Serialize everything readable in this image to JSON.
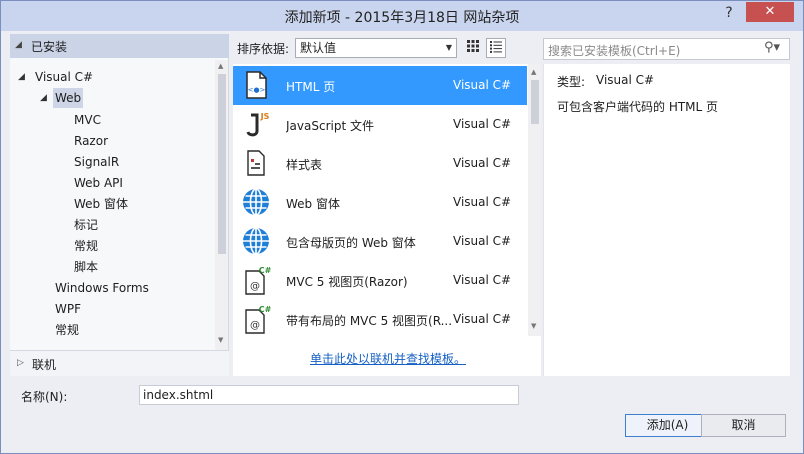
{
  "window": {
    "title": "添加新项 - 2015年3月18日 网站杂项",
    "help_label": "?",
    "close_label": "✕"
  },
  "tree": {
    "installed_label": "已安装",
    "items": [
      {
        "label": "Visual C#",
        "expanded": true
      },
      {
        "label": "Web",
        "expanded": true,
        "selected": true
      },
      {
        "label": "MVC"
      },
      {
        "label": "Razor"
      },
      {
        "label": "SignalR"
      },
      {
        "label": "Web API"
      },
      {
        "label": "Web 窗体"
      },
      {
        "label": "标记"
      },
      {
        "label": "常规"
      },
      {
        "label": "脚本"
      },
      {
        "label": "Windows Forms"
      },
      {
        "label": "WPF"
      },
      {
        "label": "常规"
      }
    ],
    "online_label": "联机"
  },
  "toolbar": {
    "sort_label": "排序依据:",
    "sort_value": "默认值",
    "view_grid_icon": "grid-view-icon",
    "view_list_icon": "list-view-icon",
    "search_placeholder": "搜索已安装模板(Ctrl+E)"
  },
  "templates": [
    {
      "name": "HTML 页",
      "lang": "Visual C#",
      "icon": "html-page-icon",
      "selected": true
    },
    {
      "name": "JavaScript 文件",
      "lang": "Visual C#",
      "icon": "javascript-file-icon"
    },
    {
      "name": "样式表",
      "lang": "Visual C#",
      "icon": "stylesheet-icon"
    },
    {
      "name": "Web 窗体",
      "lang": "Visual C#",
      "icon": "globe-icon"
    },
    {
      "name": "包含母版页的 Web 窗体",
      "lang": "Visual C#",
      "icon": "globe-icon"
    },
    {
      "name": "MVC 5 视图页(Razor)",
      "lang": "Visual C#",
      "icon": "razor-page-icon"
    },
    {
      "name": "带有布局的 MVC 5 视图页(R...",
      "lang": "Visual C#",
      "icon": "razor-page-icon"
    }
  ],
  "online_link": "单击此处以联机并查找模板。",
  "detail": {
    "type_label": "类型:",
    "type_value": "Visual C#",
    "description": "可包含客户端代码的 HTML 页"
  },
  "footer": {
    "name_label": "名称(N):",
    "name_value": "index.shtml",
    "add_label": "添加(A)",
    "cancel_label": "取消"
  }
}
